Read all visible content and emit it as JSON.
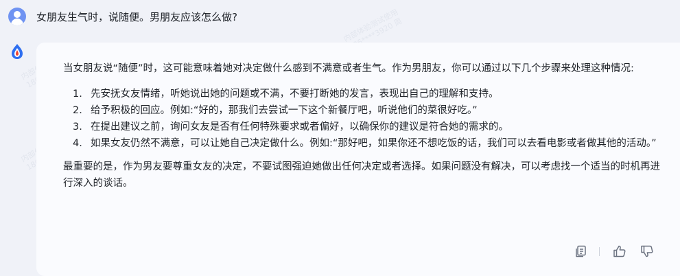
{
  "user": {
    "question": "女朋友生气时，说随便。男朋友应该怎么做?"
  },
  "answer": {
    "intro": "当女朋友说“随便”时，这可能意味着她对决定做什么感到不满意或者生气。作为男朋友，你可以通过以下几个步骤来处理这种情况:",
    "steps": [
      {
        "num": "1.",
        "text": "先安抚女友情绪，听她说出她的问题或不满，不要打断她的发言，表现出自己的理解和支持。"
      },
      {
        "num": "2.",
        "text": "给予积极的回应。例如:“好的，那我们去尝试一下这个新餐厅吧，听说他们的菜很好吃。”"
      },
      {
        "num": "3.",
        "text": "在提出建议之前，询问女友是否有任何特殊要求或者偏好，以确保你的建议是符合她的需求的。"
      },
      {
        "num": "4.",
        "text": "如果女友仍然不满意，可以让她自己决定做什么。例如:“那好吧，如果你还不想吃饭的话，我们可以去看电影或者做其他的活动。”"
      }
    ],
    "conclusion": "最重要的是，作为男友要尊重女友的决定，不要试图强迫她做出任何决定或者选择。如果问题没有解决，可以考虑找一个适当的时机再进行深入的谈话。"
  },
  "watermark": {
    "line1": "内部体验测试使用",
    "line2": "186****3920 周"
  },
  "icons": {
    "user_avatar": "user-avatar-icon",
    "bot_avatar": "flame-drop-logo-icon",
    "copy": "copy-icon",
    "like": "thumbs-up-icon",
    "dislike": "thumbs-down-icon"
  },
  "colors": {
    "background": "#f0f2f8",
    "card": "#fafbfe",
    "user_avatar": "#6f93f2",
    "logo_blue": "#2f6ff0",
    "logo_red": "#f0442f",
    "icon_gray": "#6b7280"
  }
}
